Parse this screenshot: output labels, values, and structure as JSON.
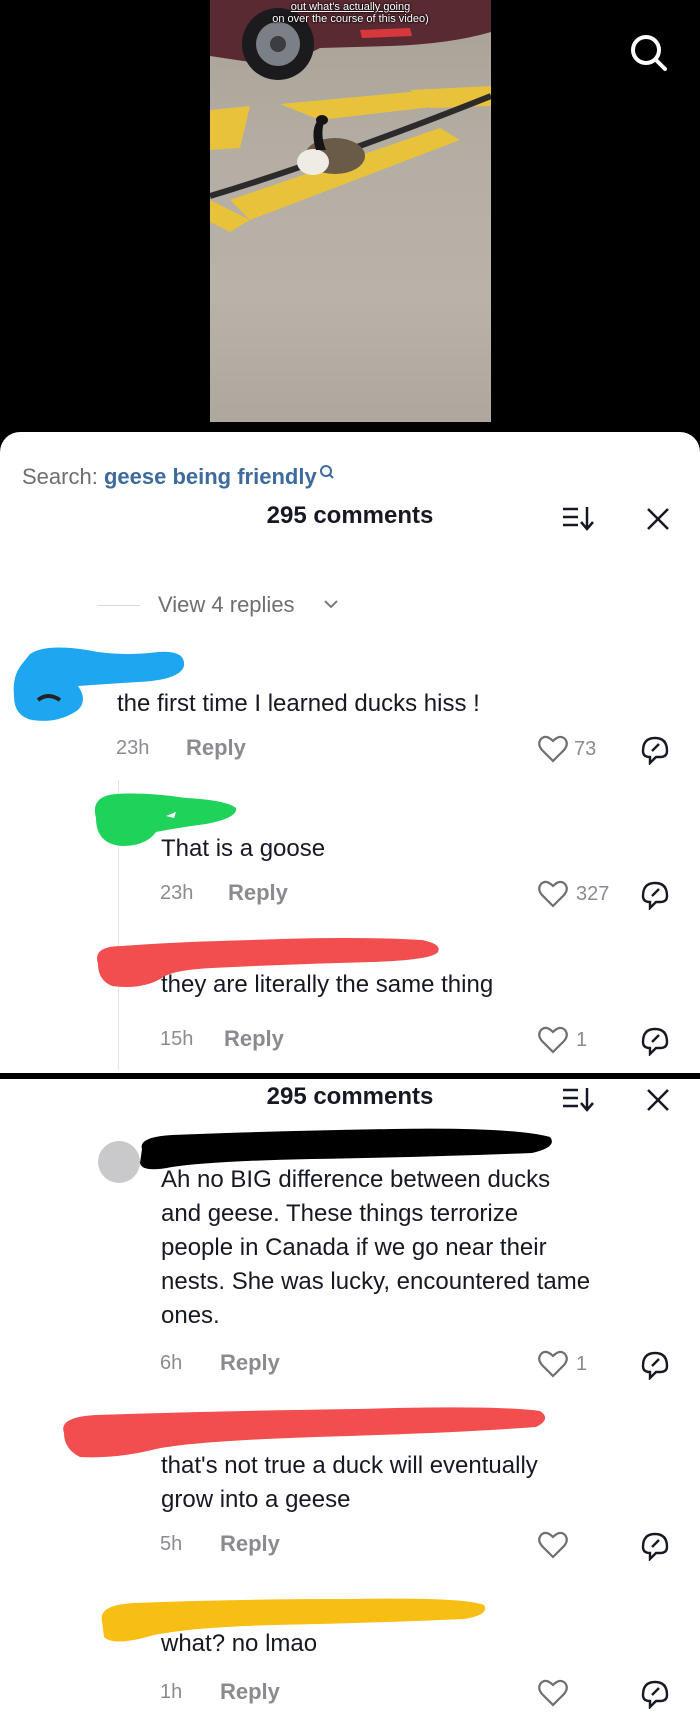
{
  "video": {
    "caption_line1": "out what's actually going",
    "caption_line2": "on over the course of this video)",
    "search_icon": "search-icon"
  },
  "search": {
    "label": "Search:",
    "query": "geese being friendly",
    "icon": "search-icon"
  },
  "panel1": {
    "count_label": "295 comments",
    "view_replies": "View 4 replies",
    "comments": [
      {
        "text": "the first time I learned ducks hiss !",
        "time": "23h",
        "reply": "Reply",
        "likes": "73"
      },
      {
        "text": "That is a goose",
        "time": "23h",
        "reply": "Reply",
        "likes": "327"
      },
      {
        "text": "they are literally the same thing",
        "time": "15h",
        "reply": "Reply",
        "likes": "1"
      }
    ]
  },
  "panel2": {
    "count_label": "295 comments",
    "comments": [
      {
        "line1": "Ah no BIG difference between ducks",
        "line2": "and geese. These things terrorize",
        "line3": "people in Canada if we go near their",
        "line4": "nests. She was lucky, encountered tame",
        "line5": "ones.",
        "time": "6h",
        "reply": "Reply",
        "likes": "1"
      },
      {
        "line1": "that's not true a duck will eventually",
        "line2": "grow into a geese",
        "time": "5h",
        "reply": "Reply",
        "likes": ""
      },
      {
        "text": "what? no lmao",
        "time": "1h",
        "reply": "Reply",
        "likes": ""
      }
    ]
  },
  "colors": {
    "text": "#161823",
    "muted": "#8a8b91",
    "link": "#3d6b9d",
    "redact_blue": "#1ea7f0",
    "redact_green": "#1fd35a",
    "redact_red": "#f24d4f",
    "redact_black": "#000000",
    "redact_yellow": "#f7be13"
  }
}
